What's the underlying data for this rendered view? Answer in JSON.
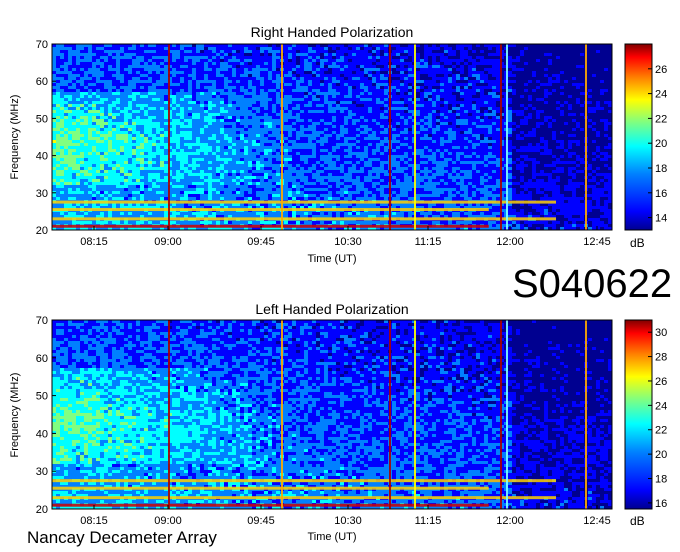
{
  "observation_id": "S040622",
  "instrument": "Nancay Decameter Array",
  "colors": {
    "background": "#ffffff",
    "colormap": [
      "#000090",
      "#0000ff",
      "#0080ff",
      "#00ffff",
      "#80ff80",
      "#ffff00",
      "#ff8000",
      "#ff0000",
      "#800000"
    ]
  },
  "chart_data": [
    {
      "type": "heatmap",
      "title": "Right Handed Polarization",
      "xlabel": "Time (UT)",
      "ylabel": "Frequency (MHz)",
      "x_ticks": [
        "08:15",
        "09:00",
        "09:45",
        "10:30",
        "11:15",
        "12:00",
        "12:45"
      ],
      "y_ticks": [
        20,
        30,
        40,
        50,
        60,
        70
      ],
      "ylim": [
        20,
        70
      ],
      "colorbar": {
        "label": "dB",
        "ticks": [
          14,
          16,
          18,
          20,
          22,
          24,
          26
        ],
        "range": [
          13,
          28
        ]
      }
    },
    {
      "type": "heatmap",
      "title": "Left Handed Polarization",
      "xlabel": "Time (UT)",
      "ylabel": "Frequency (MHz)",
      "x_ticks": [
        "08:15",
        "09:00",
        "09:45",
        "10:30",
        "11:15",
        "12:00",
        "12:45"
      ],
      "y_ticks": [
        20,
        30,
        40,
        50,
        60,
        70
      ],
      "ylim": [
        20,
        70
      ],
      "colorbar": {
        "label": "dB",
        "ticks": [
          16,
          18,
          20,
          22,
          24,
          26,
          28,
          30
        ],
        "range": [
          15.5,
          31
        ]
      }
    }
  ]
}
